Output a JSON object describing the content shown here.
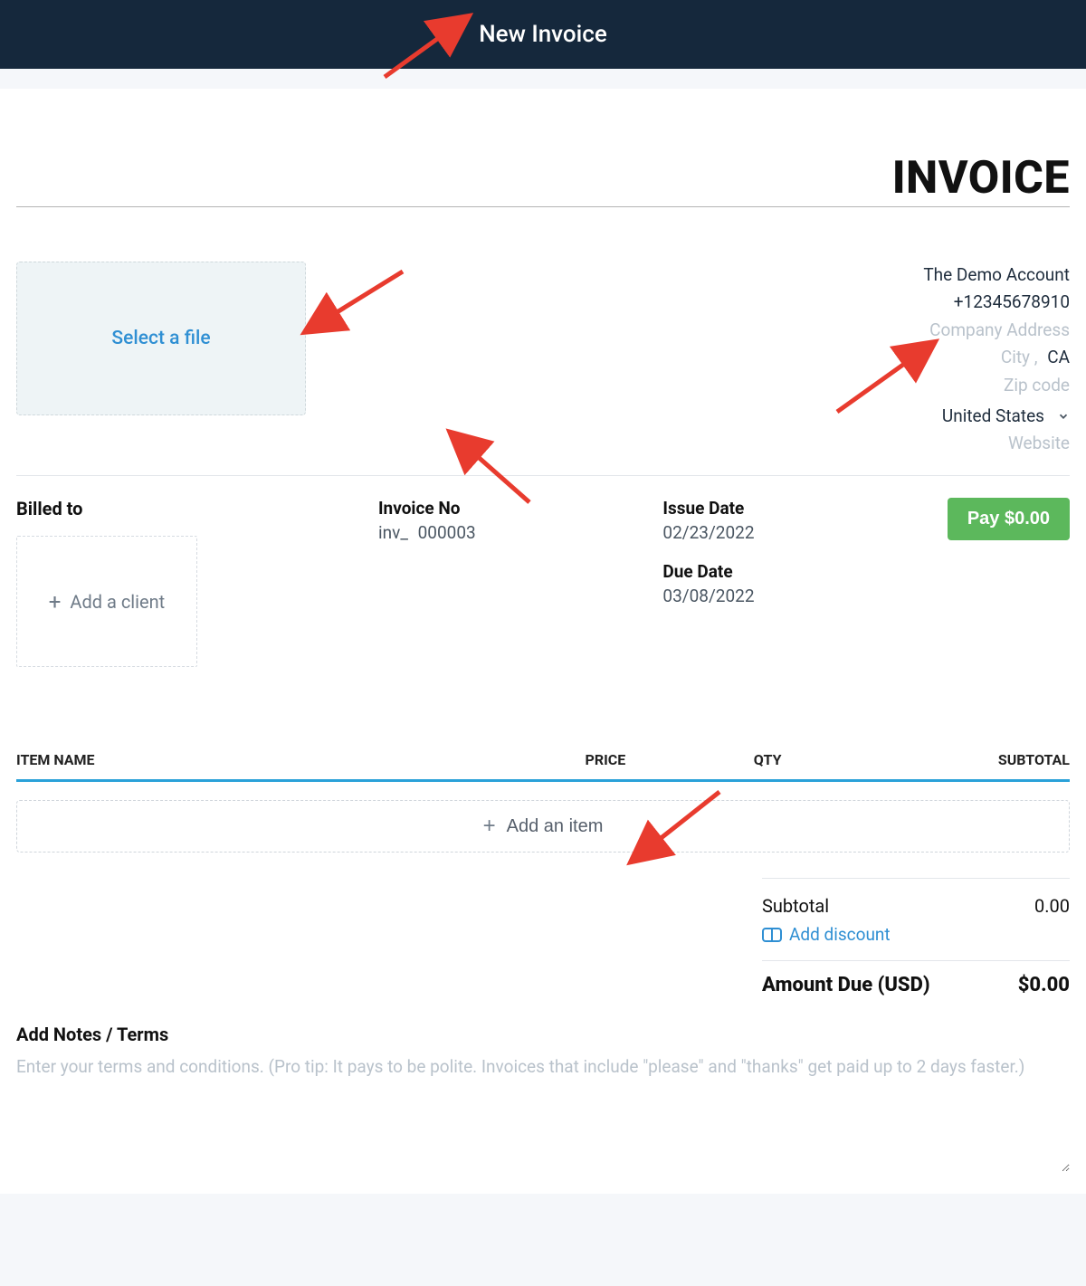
{
  "header": {
    "title": "New Invoice"
  },
  "page": {
    "title": "INVOICE"
  },
  "fileDrop": {
    "label": "Select a file"
  },
  "company": {
    "name": "The Demo Account",
    "phone": "+12345678910",
    "address_placeholder": "Company Address",
    "city_placeholder": "City",
    "state_sep": ",",
    "state": "CA",
    "zip_placeholder": "Zip code",
    "country": "United States",
    "website_placeholder": "Website"
  },
  "billed": {
    "label": "Billed to",
    "add_client_label": "Add a client"
  },
  "invoice": {
    "no_label": "Invoice No",
    "no_prefix": "inv_",
    "no_value": "000003"
  },
  "dates": {
    "issue_label": "Issue Date",
    "issue_value": "02/23/2022",
    "due_label": "Due Date",
    "due_value": "03/08/2022"
  },
  "pay": {
    "label": "Pay $0.00"
  },
  "items": {
    "headers": {
      "name": "ITEM NAME",
      "price": "PRICE",
      "qty": "QTY",
      "subtotal": "SUBTOTAL"
    },
    "add_item_label": "Add an item"
  },
  "totals": {
    "subtotal_label": "Subtotal",
    "subtotal_value": "0.00",
    "discount_label": "Add discount",
    "amount_due_label": "Amount Due (USD)",
    "amount_due_value": "$0.00"
  },
  "notes": {
    "label": "Add Notes / Terms",
    "placeholder": "Enter your terms and conditions. (Pro tip: It pays to be polite. Invoices that include \"please\" and \"thanks\" get paid up to 2 days faster.)"
  }
}
